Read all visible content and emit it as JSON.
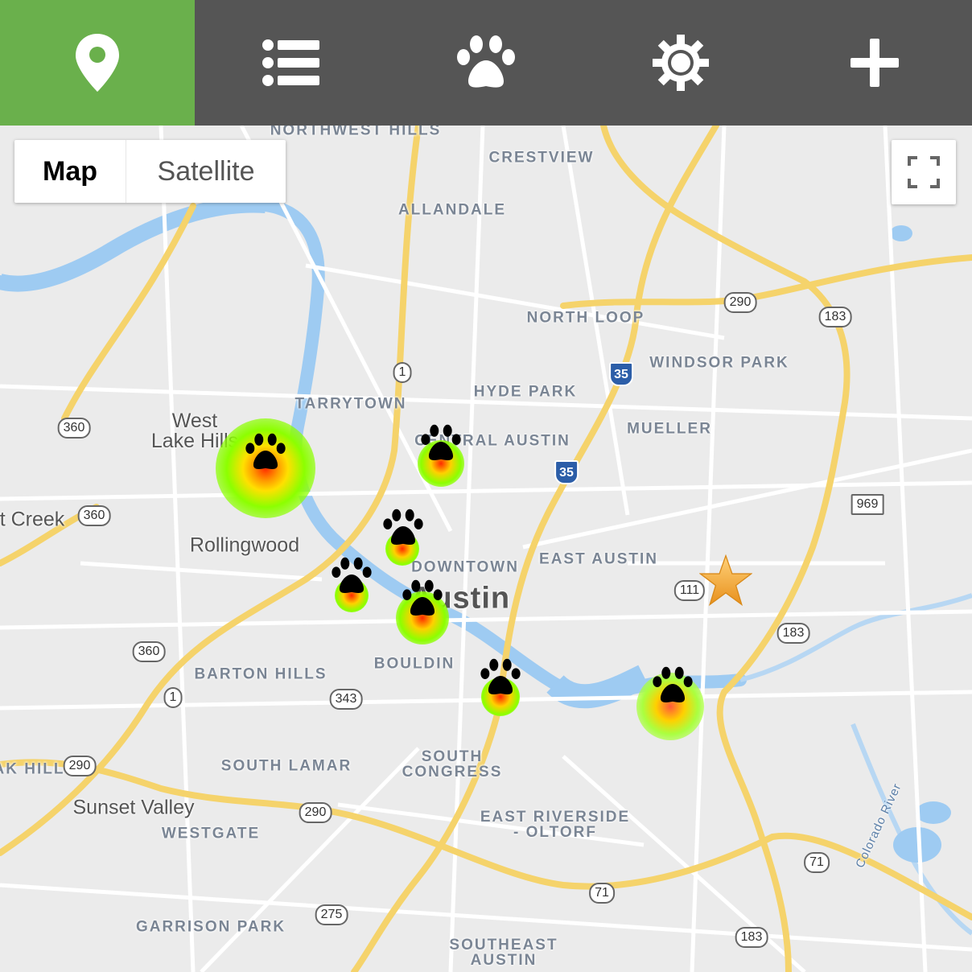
{
  "nav": {
    "tabs": [
      {
        "name": "map-tab",
        "icon": "map-pin-icon",
        "active": true
      },
      {
        "name": "list-tab",
        "icon": "list-icon",
        "active": false
      },
      {
        "name": "paw-tab",
        "icon": "paw-icon",
        "active": false
      },
      {
        "name": "settings-tab",
        "icon": "gear-icon",
        "active": false
      },
      {
        "name": "add-tab",
        "icon": "plus-icon",
        "active": false
      }
    ],
    "active_color": "#6ab04c",
    "bar_color": "#555555"
  },
  "map_controls": {
    "map_label": "Map",
    "satellite_label": "Satellite",
    "fullscreen_icon": "fullscreen-icon"
  },
  "labels": {
    "northwest_hills": "NORTHWEST HILLS",
    "crestview": "CRESTVIEW",
    "allandale": "ALLANDALE",
    "north_loop": "NORTH LOOP",
    "windsor_park": "WINDSOR PARK",
    "hyde_park": "HYDE PARK",
    "tarrytown": "TARRYTOWN",
    "mueller": "MUELLER",
    "central_austin": "CENTRAL AUSTIN",
    "west_lake_hills": "West\nLake Hills",
    "creek": "t Creek",
    "rollingwood": "Rollingwood",
    "downtown": "DOWNTOWN",
    "east_austin": "EAST AUSTIN",
    "austin": "Austin",
    "bouldin": "BOULDIN",
    "barton_hills": "BARTON HILLS",
    "south_lamar": "SOUTH LAMAR",
    "south_congress": "SOUTH\nCONGRESS",
    "sunset_valley": "Sunset Valley",
    "westgate": "WESTGATE",
    "east_riverside": "EAST RIVERSIDE\n- OLTORF",
    "garrison_park": "GARRISON PARK",
    "southeast_austin": "SOUTHEAST\nAUSTIN",
    "oak_hill": "AK HILL",
    "colorado_river": "Colorado River"
  },
  "shields": {
    "s290a": "290",
    "s183a": "183",
    "s35a": "35",
    "s1a": "1",
    "s360a": "360",
    "s35b": "35",
    "s360b": "360",
    "s969": "969",
    "s111": "111",
    "s183b": "183",
    "s360c": "360",
    "s1b": "1",
    "s343": "343",
    "s290b": "290",
    "s290c": "290",
    "s71a": "71",
    "s71b": "71",
    "s275": "275",
    "s183c": "183"
  },
  "markers": {
    "paw_count": 7,
    "user_location_icon": "star-icon",
    "heat_colors": [
      "#ff2a00",
      "#ffd000",
      "#7dff00"
    ]
  }
}
